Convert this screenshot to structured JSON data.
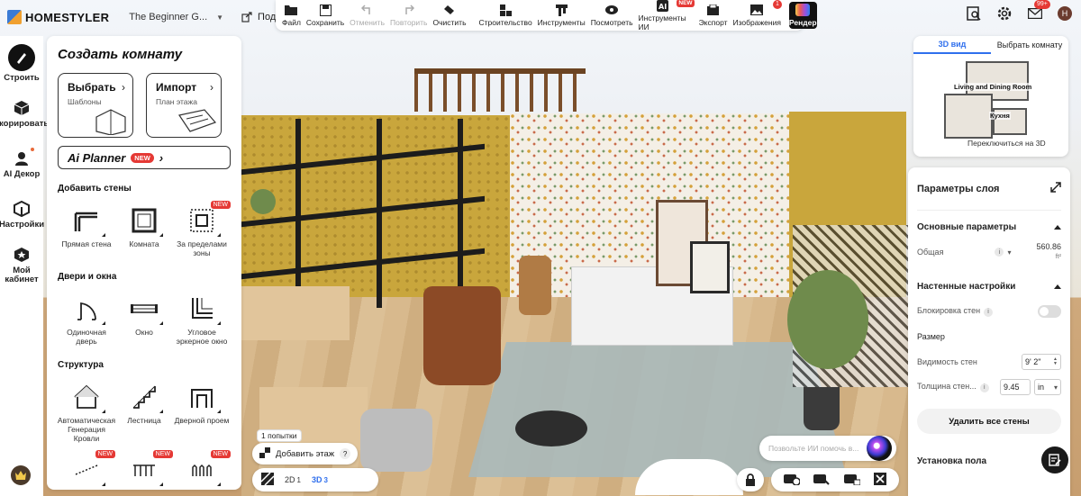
{
  "header": {
    "logo_text": "HOMESTYLER",
    "design_name": "The Beginner G...",
    "share_label": "Поделиться",
    "notification_badge": "99+",
    "avatar_initial": "H"
  },
  "toolbar": {
    "file": "Файл",
    "save": "Сохранить",
    "undo": "Отменить",
    "redo": "Повторить",
    "clear": "Очистить",
    "build": "Строительство",
    "tools": "Инструменты",
    "view": "Посмотреть",
    "ai_tools": "Инструменты ИИ",
    "ai_tools_badge": "NEW",
    "export": "Экспорт",
    "images": "Изображения",
    "images_badge": "1",
    "render": "Рендер"
  },
  "rail": {
    "items": [
      {
        "label": "Строить"
      },
      {
        "label": "екорировать"
      },
      {
        "label": "AI Декор"
      },
      {
        "label": "Настройки"
      },
      {
        "label": "Мой кабинет"
      }
    ]
  },
  "panel": {
    "title": "Создать комнату",
    "card_select_title": "Выбрать",
    "card_select_sub": "Шаблоны",
    "card_import_title": "Импорт",
    "card_import_sub": "План этажа",
    "ai_planner": "Ai Planner",
    "ai_planner_badge": "NEW",
    "walls_title": "Добавить стены",
    "walls": [
      {
        "label": "Прямая стена"
      },
      {
        "label": "Комната"
      },
      {
        "label": "За пределами зоны",
        "badge": "NEW"
      }
    ],
    "doors_title": "Двери и окна",
    "doors": [
      {
        "label": "Одиночная дверь"
      },
      {
        "label": "Окно"
      },
      {
        "label": "Угловое эркерное окно"
      }
    ],
    "structure_title": "Структура",
    "structure": [
      {
        "label": "Автоматическая Генерация Кровли"
      },
      {
        "label": "Лестница"
      },
      {
        "label": "Дверной проем"
      }
    ],
    "more_badge": "NEW"
  },
  "bottom": {
    "attempts": "1 попытки",
    "add_floor": "Добавить этаж",
    "help": "?",
    "view_2d": "2D",
    "view_2d_num": "1",
    "view_3d": "3D",
    "view_3d_num": "3",
    "ai_placeholder": "Позвольте ИИ помочь в..."
  },
  "minimap": {
    "tab_3d": "3D вид",
    "tab_select": "Выбрать комнату",
    "room_living": "Living and Dining Room",
    "room_kitchen": "Кухня",
    "switch_label": "Переключиться на 3D"
  },
  "props": {
    "title": "Параметры слоя",
    "basic_section": "Основные параметры",
    "total_label": "Общая",
    "total_value": "560.86",
    "total_unit": "ft²",
    "wall_section": "Настенные настройки",
    "wall_lock_label": "Блокировка стен",
    "size_label": "Размер",
    "wall_visibility_label": "Видимость стен",
    "wall_visibility_value": "9' 2\"",
    "wall_thickness_label": "Толщина стен...",
    "wall_thickness_value": "9.45",
    "wall_thickness_unit": "in",
    "delete_walls": "Удалить все стены",
    "floor_section": "Установка пола"
  }
}
